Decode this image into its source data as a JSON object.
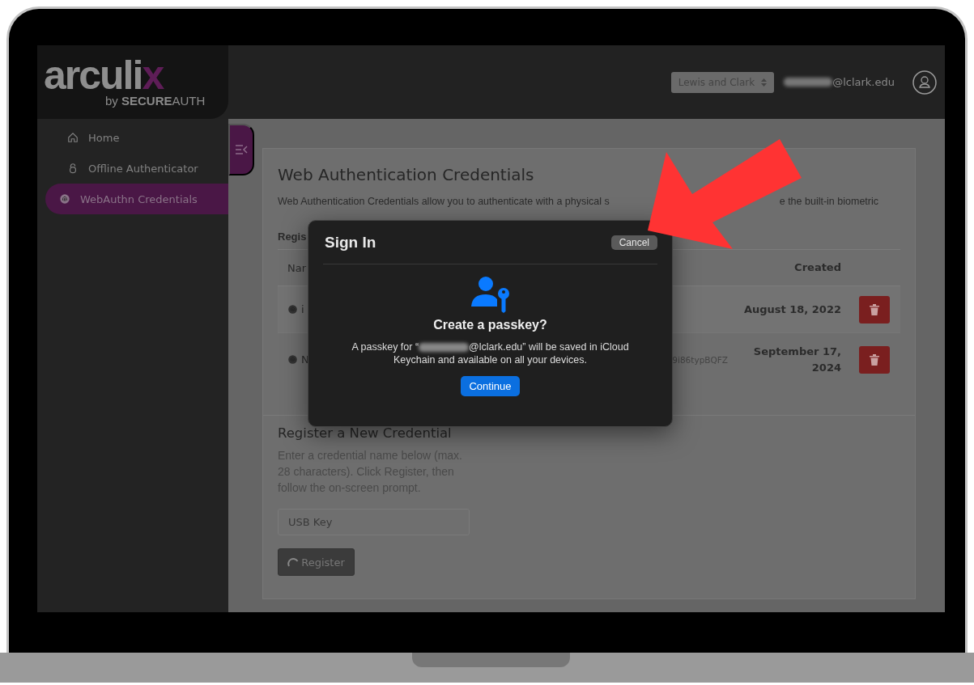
{
  "logo": {
    "name": "arculi",
    "accent": "x",
    "byline": "by **SECURE**AUTH"
  },
  "header": {
    "organization": "Lewis and Clark",
    "email_domain": "@lclark.edu"
  },
  "sidebar": {
    "items": [
      {
        "label": "Home",
        "selected": false
      },
      {
        "label": "Offline Authenticator",
        "selected": false
      },
      {
        "label": "WebAuthn Credentials",
        "selected": true
      }
    ]
  },
  "page": {
    "title": "Web Authentication Credentials",
    "description_start": "Web Authentication Credentials allow you to authenticate with a physical s",
    "description_end": "e the built-in biometric",
    "section_label": "Regis",
    "table": {
      "columns": [
        "Nar",
        "Created"
      ],
      "rows": [
        {
          "name": "i",
          "created": "August 18, 2022"
        },
        {
          "name": "N",
          "credential_id": "9i86typBQFZ",
          "created": "September 17, 2024"
        }
      ]
    },
    "register": {
      "title": "Register a New Credential",
      "help": "Enter a credential name below (max. 28 characters). Click Register, then follow the on-screen prompt.",
      "input_value": "USB Key",
      "button": "Register"
    }
  },
  "dialog": {
    "title": "Sign In",
    "cancel": "Cancel",
    "heading": "Create a passkey?",
    "message_start": "A passkey for “",
    "message_end": "@lclark.edu” will be saved in iCloud Keychain and available on all your devices.",
    "button": "Continue"
  }
}
